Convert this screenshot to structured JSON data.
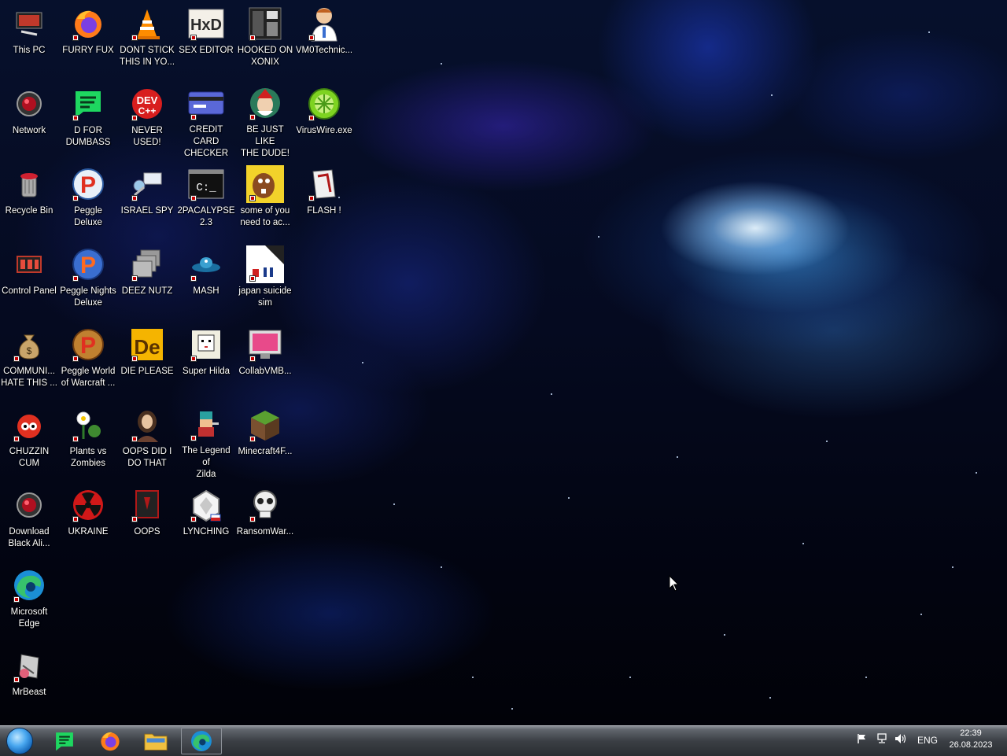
{
  "desktop": {
    "icons": [
      {
        "label": "This PC",
        "icon": "computer-icon"
      },
      {
        "label": "Network",
        "icon": "network-icon"
      },
      {
        "label": "Recycle Bin",
        "icon": "recycle-bin-icon"
      },
      {
        "label": "Control Panel",
        "icon": "control-panel-icon"
      },
      {
        "label": "COMMUNI...\nHATE THIS ...",
        "icon": "money-bag-icon"
      },
      {
        "label": "CHUZZIN\nCUM",
        "icon": "chuzzle-icon"
      },
      {
        "label": "Download\nBlack Ali...",
        "icon": "download-icon"
      },
      {
        "label": "Microsoft\nEdge",
        "icon": "edge-icon"
      },
      {
        "label": "MrBeast",
        "icon": "mrbeast-icon"
      },
      {
        "label": "FURRY FUX",
        "icon": "firefox-icon"
      },
      {
        "label": "D FOR\nDUMBASS",
        "icon": "chat-icon"
      },
      {
        "label": "Peggle Deluxe",
        "icon": "peggle-icon"
      },
      {
        "label": "Peggle Nights\nDeluxe",
        "icon": "peggle-nights-icon"
      },
      {
        "label": "Peggle World\nof Warcraft ...",
        "icon": "peggle-warcraft-icon"
      },
      {
        "label": "Plants vs\nZombies",
        "icon": "plant-icon"
      },
      {
        "label": "UKRAINE",
        "icon": "radiation-icon"
      },
      {
        "label": "DONT STICK\nTHIS IN YO...",
        "icon": "traffic-cone-icon"
      },
      {
        "label": "NEVER USED!",
        "icon": "devcpp-icon"
      },
      {
        "label": "ISRAEL SPY",
        "icon": "spy-camera-icon"
      },
      {
        "label": "DEEZ NUTZ",
        "icon": "windows-stack-icon"
      },
      {
        "label": "DIE PLEASE",
        "icon": "de-icon"
      },
      {
        "label": "OOPS DID I\nDO THAT",
        "icon": "portrait-icon"
      },
      {
        "label": "OOPS",
        "icon": "oops-icon"
      },
      {
        "label": "SEX EDITOR",
        "icon": "hex-editor-icon"
      },
      {
        "label": "CREDIT CARD\nCHECKER",
        "icon": "credit-card-icon"
      },
      {
        "label": "2PACALYPSE\n2.3",
        "icon": "terminal-icon"
      },
      {
        "label": "MASH",
        "icon": "ufo-icon"
      },
      {
        "label": "Super Hilda",
        "icon": "pixel-dog-icon"
      },
      {
        "label": "The Legend of\nZilda",
        "icon": "pixel-hero-icon"
      },
      {
        "label": "LYNCHING",
        "icon": "emblem-icon"
      },
      {
        "label": "HOOKED ON\nXONIX",
        "icon": "xonix-icon"
      },
      {
        "label": "BE JUST LIKE\nTHE DUDE!",
        "icon": "santa-icon"
      },
      {
        "label": "some of you\nneed to ac...",
        "icon": "beaver-icon"
      },
      {
        "label": "japan suicide\nsim",
        "icon": "japan-sim-icon"
      },
      {
        "label": "CollabVMB...",
        "icon": "monitor-icon"
      },
      {
        "label": "Minecraft4F...",
        "icon": "minecraft-icon"
      },
      {
        "label": "RansomWar...",
        "icon": "skull-icon"
      },
      {
        "label": "VM0Technic...",
        "icon": "doctor-icon"
      },
      {
        "label": "VirusWire.exe",
        "icon": "limewire-icon"
      },
      {
        "label": "FLASH !",
        "icon": "flash-icon"
      }
    ]
  },
  "taskbar": {
    "pinned": [
      {
        "name": "chat-app",
        "icon": "chat-icon",
        "active": false
      },
      {
        "name": "firefox",
        "icon": "firefox-icon",
        "active": false
      },
      {
        "name": "file-explorer",
        "icon": "folder-icon",
        "active": false
      },
      {
        "name": "edge",
        "icon": "edge-icon",
        "active": true
      }
    ],
    "tray": {
      "icons": [
        "flag-icon",
        "network-icon",
        "volume-icon"
      ],
      "language": "ENG",
      "time": "22:39",
      "date": "26.08.2023"
    }
  }
}
